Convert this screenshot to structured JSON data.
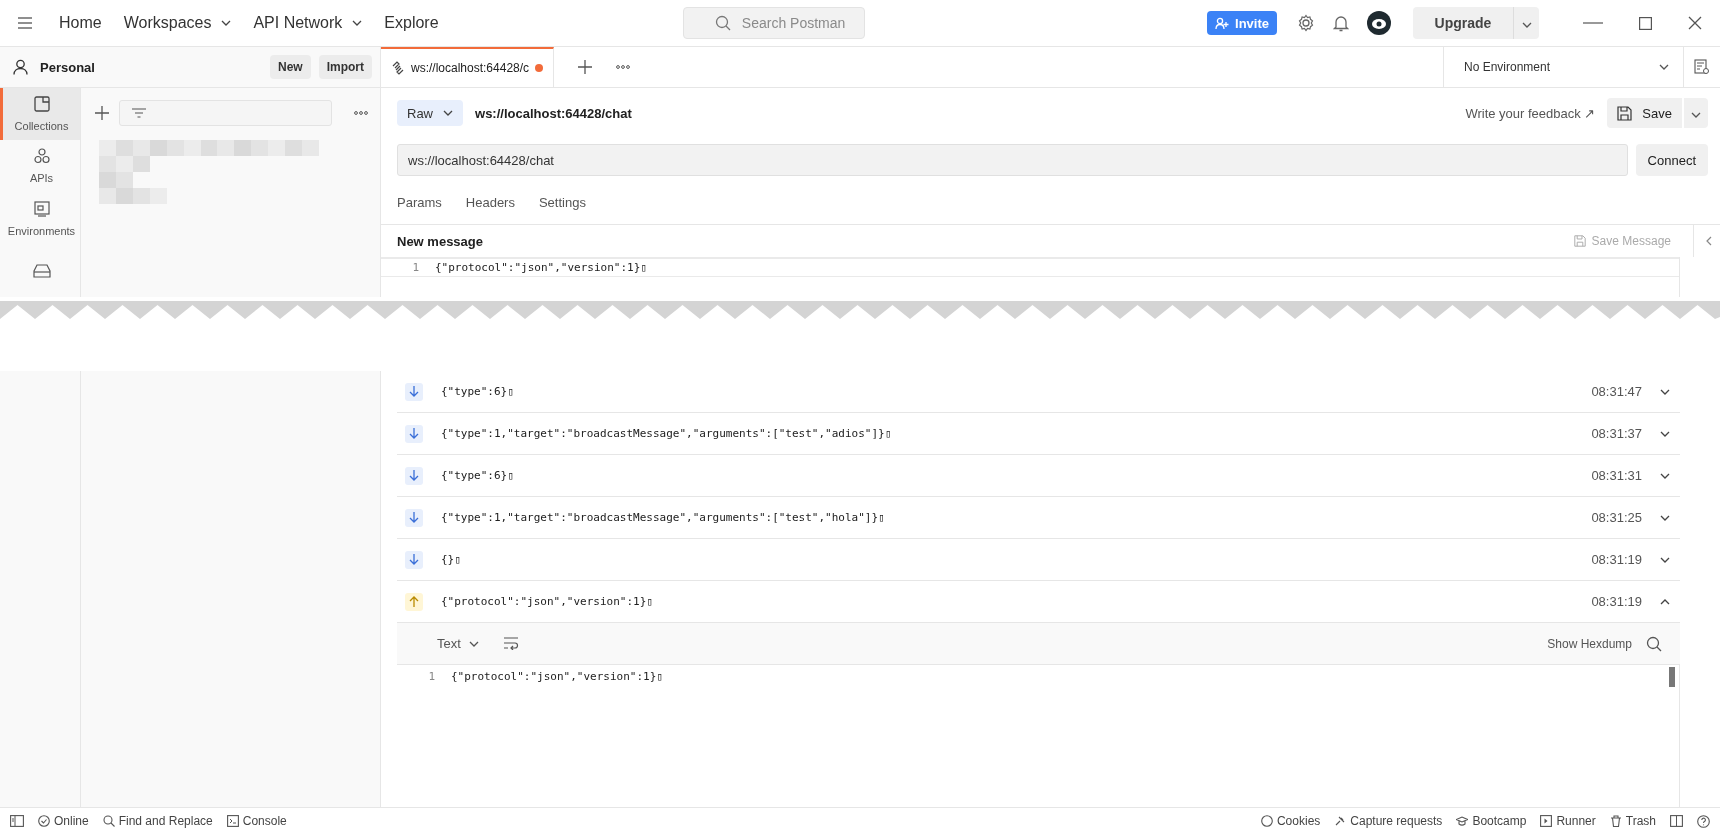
{
  "top_bar": {
    "menu": [
      "Home",
      "Workspaces",
      "API Network",
      "Explore"
    ],
    "search": {
      "placeholder": "Search Postman"
    },
    "invite": "Invite",
    "upgrade": "Upgrade"
  },
  "sidebar": {
    "workspace": "Personal",
    "new": "New",
    "import": "Import",
    "nav": [
      {
        "label": "Collections",
        "kind": "collections",
        "selected": true
      },
      {
        "label": "APIs",
        "kind": "apis",
        "selected": false
      },
      {
        "label": "Environments",
        "kind": "environments",
        "selected": false
      },
      {
        "kind": "mock",
        "selected": false
      }
    ]
  },
  "tabs": [
    {
      "label": "ws://localhost:64428/c",
      "unsaved": true,
      "selected": true
    }
  ],
  "environment": "No Environment",
  "request": {
    "mode": "Raw",
    "title": "ws://localhost:64428/chat",
    "feedback": "Write your feedback ↗",
    "save": "Save",
    "url": "ws://localhost:64428/chat",
    "connect": "Connect",
    "subtabs": [
      {
        "label": "Params",
        "selected": false
      },
      {
        "label": "Headers",
        "selected": false
      },
      {
        "label": "Settings",
        "selected": false
      }
    ],
    "message_title": "New message",
    "save_message": "Save Message",
    "editor_lines": [
      {
        "number": "1",
        "text": "{\"protocol\":\"json\",\"version\":1}▯"
      }
    ]
  },
  "messages": [
    {
      "outgoing": false,
      "text": "{\"type\":6}▯",
      "time": "08:31:47",
      "expanded": false
    },
    {
      "outgoing": false,
      "text": "{\"type\":1,\"target\":\"broadcastMessage\",\"arguments\":[\"test\",\"adios\"]}▯",
      "time": "08:31:37",
      "expanded": false
    },
    {
      "outgoing": false,
      "text": "{\"type\":6}▯",
      "time": "08:31:31",
      "expanded": false
    },
    {
      "outgoing": false,
      "text": "{\"type\":1,\"target\":\"broadcastMessage\",\"arguments\":[\"test\",\"hola\"]}▯",
      "time": "08:31:25",
      "expanded": false
    },
    {
      "outgoing": false,
      "text": "{}▯",
      "time": "08:31:19",
      "expanded": false
    },
    {
      "outgoing": true,
      "text": "{\"protocol\":\"json\",\"version\":1}▯",
      "time": "08:31:19",
      "expanded": true
    }
  ],
  "detail": {
    "format": "Text",
    "hexdump": "Show Hexdump",
    "lines": [
      {
        "number": "1",
        "text": "{\"protocol\":\"json\",\"version\":1}▯"
      }
    ]
  },
  "status_bar": {
    "left": [
      "Online",
      "Find and Replace",
      "Console"
    ],
    "right": [
      "Cookies",
      "Capture requests",
      "Bootcamp",
      "Runner",
      "Trash"
    ]
  }
}
